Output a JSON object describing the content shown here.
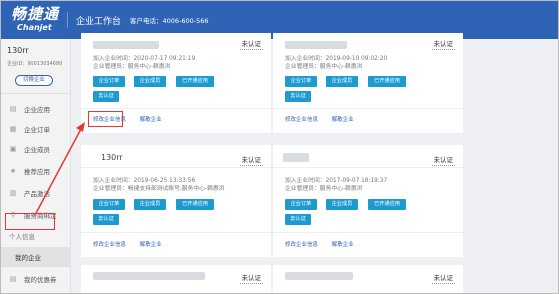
{
  "header": {
    "logo_cn": "畅捷通",
    "logo_en": "Chanjet",
    "title": "企业工作台",
    "phone": "客户电话：4006-600-566"
  },
  "sidebar": {
    "org_name": "130rr",
    "org_id": "企业ID：90013034680",
    "switch_label": "切换企业",
    "items": [
      {
        "label": "企业应用",
        "icon": "apps-icon"
      },
      {
        "label": "企业订单",
        "icon": "order-icon"
      },
      {
        "label": "企业成员",
        "icon": "members-icon"
      },
      {
        "label": "推荐应用",
        "icon": "star-icon"
      },
      {
        "label": "产品激活",
        "icon": "activate-icon"
      },
      {
        "label": "服务商绑定",
        "icon": "link-icon"
      }
    ],
    "group_label": "个人信息",
    "my_enterprise": "我的企业",
    "my_coupon": "我的优惠券"
  },
  "cards": [
    {
      "title": "",
      "status": "未认证",
      "join_time": "加入企业时间：2020-07-17 09:21:19",
      "admin": "企业管理员：服务中心-赖惠洪",
      "buttons": [
        "企业订单",
        "企业成员",
        "已开通应用",
        "去认证"
      ],
      "links": [
        "修改企业信息",
        "解散企业"
      ]
    },
    {
      "title": "",
      "status": "未认证",
      "join_time": "加入企业时间：2019-09-10 09:02:20",
      "admin": "企业管理员：服务中心-赖惠洪",
      "buttons": [
        "企业订单",
        "企业成员",
        "已开通应用",
        "去认证"
      ],
      "links": [
        "修改企业信息",
        "解散企业"
      ]
    },
    {
      "title": "130rr",
      "status": "未认证",
      "join_time": "加入企业时间：2019-06-25 13:33:56",
      "admin": "企业管理员：畅捷支持部测试账号,服务中心-赖惠洪",
      "buttons": [
        "企业订单",
        "企业成员",
        "已开通应用",
        "去认证"
      ],
      "links": [
        "修改企业信息",
        "解散企业"
      ]
    },
    {
      "title": "",
      "status": "未认证",
      "join_time": "加入企业时间：2017-09-07 18:19:37",
      "admin": "企业管理员：服务中心-赖惠洪",
      "buttons": [
        "企业订单",
        "企业成员",
        "已开通应用",
        "去认证"
      ],
      "links": [
        "修改企业信息",
        "解散企业"
      ]
    },
    {
      "title": "",
      "status": "未认证"
    },
    {
      "title": "",
      "status": "未认证"
    }
  ],
  "colors": {
    "header_bg": "#2f63b6",
    "button_bg": "#1d9bd1",
    "highlight": "#e53935"
  }
}
